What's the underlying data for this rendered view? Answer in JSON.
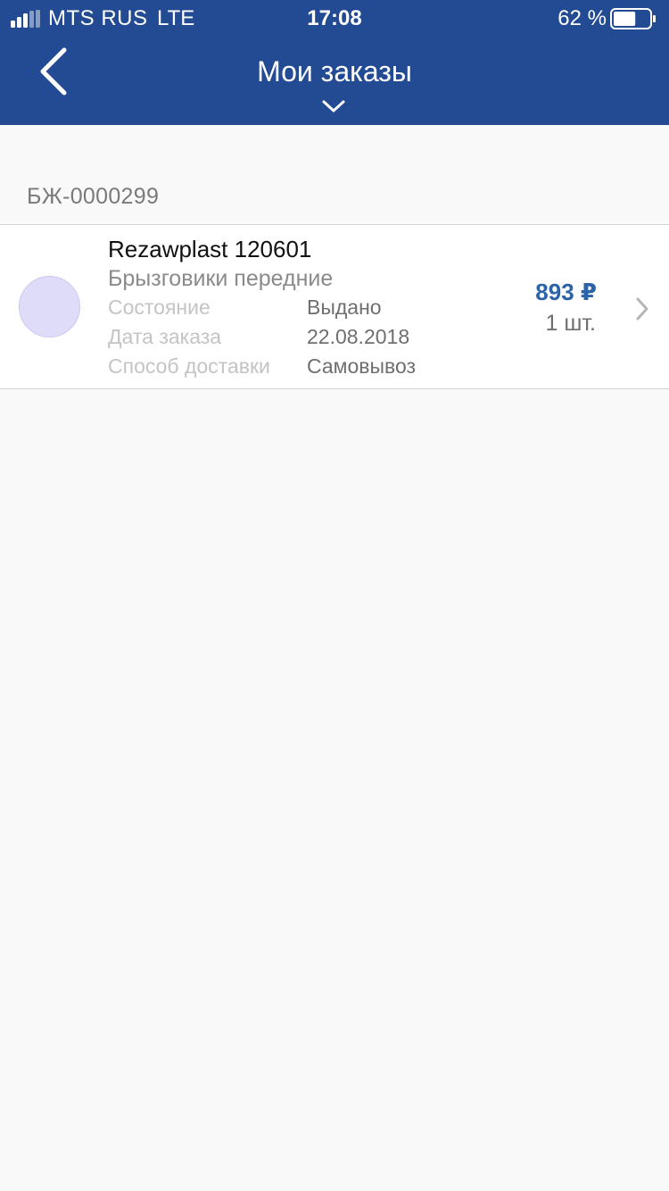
{
  "status_bar": {
    "carrier": "MTS RUS",
    "network": "LTE",
    "time": "17:08",
    "battery_percent": "62 %",
    "battery_level": 0.62,
    "signal_bars_filled": 3,
    "signal_bars_total": 5
  },
  "nav": {
    "title": "Мои заказы",
    "back_icon": "chevron-left-icon",
    "dropdown_icon": "chevron-down-icon"
  },
  "order": {
    "number": "БЖ-0000299",
    "item": {
      "title": "Rezawplast 120601",
      "subtitle": "Брызговики передние",
      "fields": [
        {
          "label": "Состояние",
          "value": "Выдано"
        },
        {
          "label": "Дата заказа",
          "value": "22.08.2018"
        },
        {
          "label": "Способ доставки",
          "value": "Самовывоз"
        }
      ],
      "price": "893 ₽",
      "quantity": "1 шт."
    }
  },
  "colors": {
    "header_bg": "#224b93",
    "price": "#2a63a8",
    "page_bg": "#f9f9f9",
    "thumbnail": "#dedcf8"
  }
}
